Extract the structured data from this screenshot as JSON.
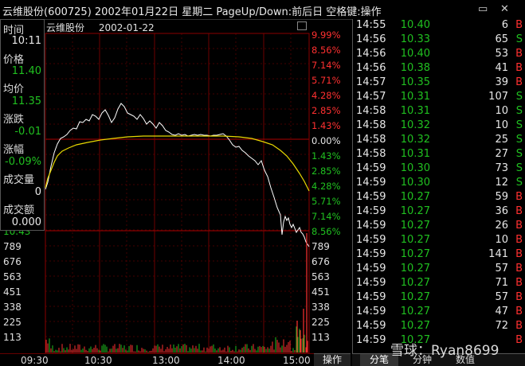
{
  "window": {
    "title": "云维股份(600725) 2002年01月22日 星期二 PageUp/Down:前后日 空格键:操作",
    "minimize_glyph": "▭",
    "close_glyph": "✕"
  },
  "chart_header": {
    "stock_name": "云维股份",
    "date": "2002-01-22"
  },
  "info": {
    "time_label": "时间",
    "time_value": "10:11",
    "price_label": "价格",
    "price_value": "11.40",
    "avg_label": "均价",
    "avg_value": "11.35",
    "change_label": "涨跌",
    "change_value": "-0.01",
    "change_pct_label": "涨幅",
    "change_pct_value": "-0.09%",
    "volume_label": "成交量",
    "volume_value": "0",
    "amount_label": "成交额",
    "amount_value": "0.000",
    "hidden_price": "10.43"
  },
  "pct_axis": {
    "up": [
      "9.99%",
      "8.56%",
      "7.14%",
      "5.71%",
      "4.28%",
      "2.85%",
      "1.43%"
    ],
    "zero": "0.00%",
    "down": [
      "1.43%",
      "2.85%",
      "4.28%",
      "5.71%",
      "7.14%",
      "8.56%"
    ]
  },
  "volume_axis": [
    "789",
    "676",
    "563",
    "451",
    "338",
    "225",
    "113"
  ],
  "time_axis": [
    "09:30",
    "10:30",
    "13:00",
    "14:00",
    "15:00"
  ],
  "operate_button": "操作",
  "ticks": [
    {
      "time": "14:55",
      "price": "10.40",
      "vol": "6",
      "side": "B"
    },
    {
      "time": "14:56",
      "price": "10.33",
      "vol": "65",
      "side": "S"
    },
    {
      "time": "14:56",
      "price": "10.40",
      "vol": "53",
      "side": "B"
    },
    {
      "time": "14:56",
      "price": "10.38",
      "vol": "41",
      "side": "B"
    },
    {
      "time": "14:57",
      "price": "10.35",
      "vol": "39",
      "side": "B"
    },
    {
      "time": "14:57",
      "price": "10.31",
      "vol": "107",
      "side": "S"
    },
    {
      "time": "14:58",
      "price": "10.31",
      "vol": "10",
      "side": "S"
    },
    {
      "time": "14:58",
      "price": "10.32",
      "vol": "10",
      "side": "S"
    },
    {
      "time": "14:58",
      "price": "10.32",
      "vol": "25",
      "side": "S"
    },
    {
      "time": "14:58",
      "price": "10.31",
      "vol": "27",
      "side": "S"
    },
    {
      "time": "14:59",
      "price": "10.30",
      "vol": "73",
      "side": "S"
    },
    {
      "time": "14:59",
      "price": "10.30",
      "vol": "12",
      "side": "S"
    },
    {
      "time": "14:59",
      "price": "10.27",
      "vol": "59",
      "side": "B"
    },
    {
      "time": "14:59",
      "price": "10.27",
      "vol": "36",
      "side": "B"
    },
    {
      "time": "14:59",
      "price": "10.27",
      "vol": "26",
      "side": "B"
    },
    {
      "time": "14:59",
      "price": "10.27",
      "vol": "10",
      "side": "B"
    },
    {
      "time": "14:59",
      "price": "10.27",
      "vol": "141",
      "side": "B"
    },
    {
      "time": "14:59",
      "price": "10.27",
      "vol": "57",
      "side": "B"
    },
    {
      "time": "14:59",
      "price": "10.27",
      "vol": "71",
      "side": "B"
    },
    {
      "time": "14:59",
      "price": "10.27",
      "vol": "57",
      "side": "B"
    },
    {
      "time": "14:59",
      "price": "10.27",
      "vol": "47",
      "side": "B"
    },
    {
      "time": "14:59",
      "price": "10.27",
      "vol": "72",
      "side": "B"
    },
    {
      "time": "14:59",
      "price": "10.27",
      "vol": "",
      "side": "B"
    }
  ],
  "bottom_tabs": [
    "分笔",
    "分钟",
    "数值"
  ],
  "watermark": "雪球：Ryan8699",
  "colors": {
    "up": "#ff3030",
    "down": "#20c020",
    "price_line": "#ffffff",
    "avg_line": "#e8d800",
    "grid": "#8a0000"
  }
}
